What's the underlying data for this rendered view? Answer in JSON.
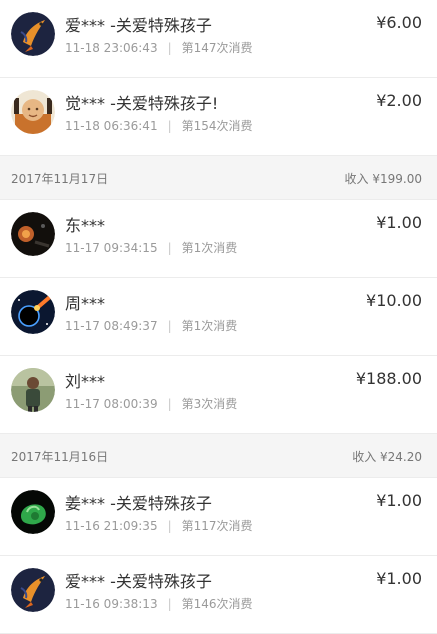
{
  "groups": [
    {
      "date": "",
      "total": "",
      "items": [
        {
          "name": "爱*** -关爱特殊孩子",
          "time": "11-18 23:06:43",
          "count": "第147次消费",
          "amount": "¥6.00",
          "avatar": "koi-fish-avatar"
        },
        {
          "name": "觉*** -关爱特殊孩子!",
          "time": "11-18 06:36:41",
          "count": "第154次消费",
          "amount": "¥2.00",
          "avatar": "buddha-avatar"
        }
      ]
    },
    {
      "date": "2017年11月17日",
      "total": "收入 ¥199.00",
      "items": [
        {
          "name": "东***",
          "time": "11-17 09:34:15",
          "count": "第1次消费",
          "amount": "¥1.00",
          "avatar": "night-avatar"
        },
        {
          "name": "周***",
          "time": "11-17 08:49:37",
          "count": "第1次消费",
          "amount": "¥10.00",
          "avatar": "space-avatar"
        },
        {
          "name": "刘***",
          "time": "11-17 08:00:39",
          "count": "第3次消费",
          "amount": "¥188.00",
          "avatar": "person-avatar"
        }
      ]
    },
    {
      "date": "2017年11月16日",
      "total": "收入 ¥24.20",
      "items": [
        {
          "name": "姜*** -关爱特殊孩子",
          "time": "11-16 21:09:35",
          "count": "第117次消费",
          "amount": "¥1.00",
          "avatar": "jade-avatar"
        },
        {
          "name": "爱*** -关爱特殊孩子",
          "time": "11-16 09:38:13",
          "count": "第146次消费",
          "amount": "¥1.00",
          "avatar": "koi-fish-avatar"
        }
      ]
    }
  ]
}
